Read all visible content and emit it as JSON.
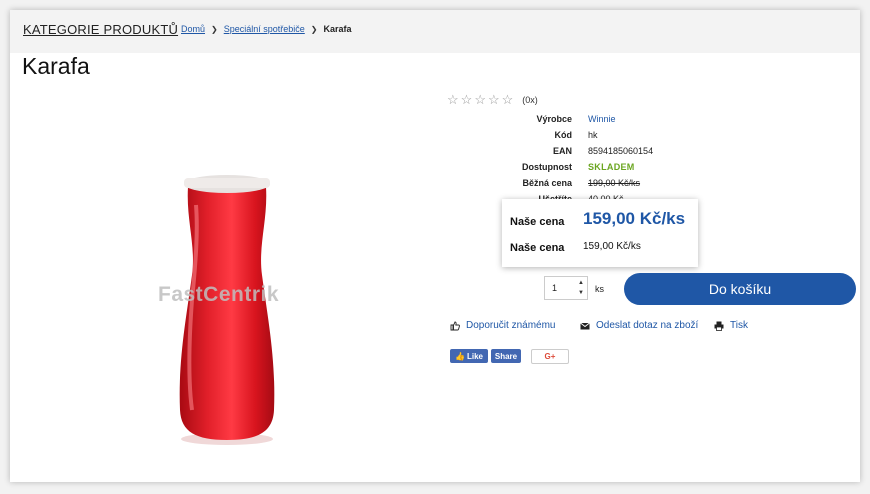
{
  "header": {
    "category_link": "KATEGORIE PRODUKTŮ",
    "breadcrumb": [
      "Domů",
      "Speciální spotřebiče",
      "Karafa"
    ]
  },
  "product": {
    "title": "Karafa",
    "watermark": "FastCentrik",
    "rating": {
      "stars_filled": 0,
      "stars_total": 5,
      "count_text": "(0x)"
    },
    "specs": [
      {
        "label": "Výrobce",
        "value": "Winnie"
      },
      {
        "label": "Kód",
        "value": "hk"
      },
      {
        "label": "EAN",
        "value": "8594185060154"
      },
      {
        "label": "Dostupnost",
        "value": "SKLADEM"
      },
      {
        "label": "Běžná cena",
        "value": "199,00 Kč/ks"
      },
      {
        "label": "Ušetříte",
        "value": "40,00 Kč"
      }
    ],
    "price_box": {
      "label1": "Naše cena",
      "value1": "159,00 Kč/ks",
      "label2": "Naše cena",
      "value2": "159,00 Kč/ks"
    },
    "quantity": {
      "value": "1",
      "unit": "ks"
    },
    "cart_button": "Do košíku",
    "actions": [
      "Doporučit známému",
      "Odeslat dotaz na zboží",
      "Tisk"
    ],
    "social": {
      "like": "Like",
      "share": "Share",
      "gplus": "G+"
    }
  },
  "colors": {
    "accent": "#1f57a6",
    "stock": "#6aa51f",
    "bottle": "#d8141e"
  }
}
